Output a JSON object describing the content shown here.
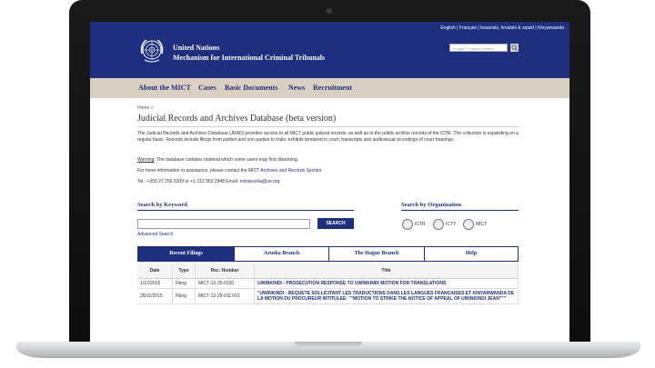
{
  "header": {
    "languages": "English | Français | bosanski, hrvatski & srpski | Kinyarwanda",
    "org_line1": "United Nations",
    "org_line2": "Mechanism for International Criminal Tribunals",
    "search_placeholder": "Google™ Custom Search"
  },
  "nav": {
    "items": [
      "About the MICT",
      "Cases",
      "Basic Documents",
      "News",
      "Recruitment"
    ]
  },
  "breadcrumb": "Home >",
  "page_title": "Judicial Records and Archives Database (beta version)",
  "intro": {
    "p1": "The Judicial Records and Archives Database (JRAD) provides access to all MICT public judicial records, as well as to the public archive records of the ICTR. The collection is expanding on a regular basis. Records include filings from parties and non-parties to trials; exhibits tendered in court; transcripts and audiovisual recordings of court hearings.",
    "warning_label": "Warning",
    "warning_text": ": The database contains material which some users may find disturbing.",
    "contact_prefix": "For more information or assistance, please contact the ",
    "contact_link": "MICT Archives and Records Section.",
    "phones": "Tel.: +255 27 256 5309 or +1 212 963 2848 Email: ",
    "email": "mictarusha@un.org"
  },
  "keyword": {
    "heading": "Search by Keyword",
    "button": "SEARCH",
    "advanced": "Advanced Search"
  },
  "organization": {
    "heading": "Search by Organization",
    "orgs": [
      "ICTR",
      "ICTY",
      "MICT"
    ]
  },
  "tabs": [
    "Recent Filings",
    "Arusha Branch",
    "The Hague Branch",
    "Help"
  ],
  "table": {
    "headers": [
      "Date",
      "Type",
      "Rec. Number",
      "Title"
    ],
    "rows": [
      {
        "date": "1/12/2015",
        "type": "Filing",
        "rec": "MICT-12-25-0120",
        "title": "UWINKINDI - PROSECUTION RESPONSE TO UWINKINDI MOTION FOR TRANSLATIONS"
      },
      {
        "date": "28/11/2015",
        "type": "Filing",
        "rec": "MICT-12-25-0117/01",
        "title": "\"UWINKINDI - REQUETE SOLLICITANT LES TRADUCTIONS DANS LES LANGUES FRANCAISES ET KINYARWANDA DE LA MOTION DU PROCUREUR INTITULEE: \"\"MOTION TO STRIKE THE NOTICE OF APPEAL OF UWINKINDI JEAN\"\"\""
      }
    ]
  },
  "colors": {
    "brand_blue": "#1d2f7e",
    "nav_bg": "#d9d0c2"
  }
}
